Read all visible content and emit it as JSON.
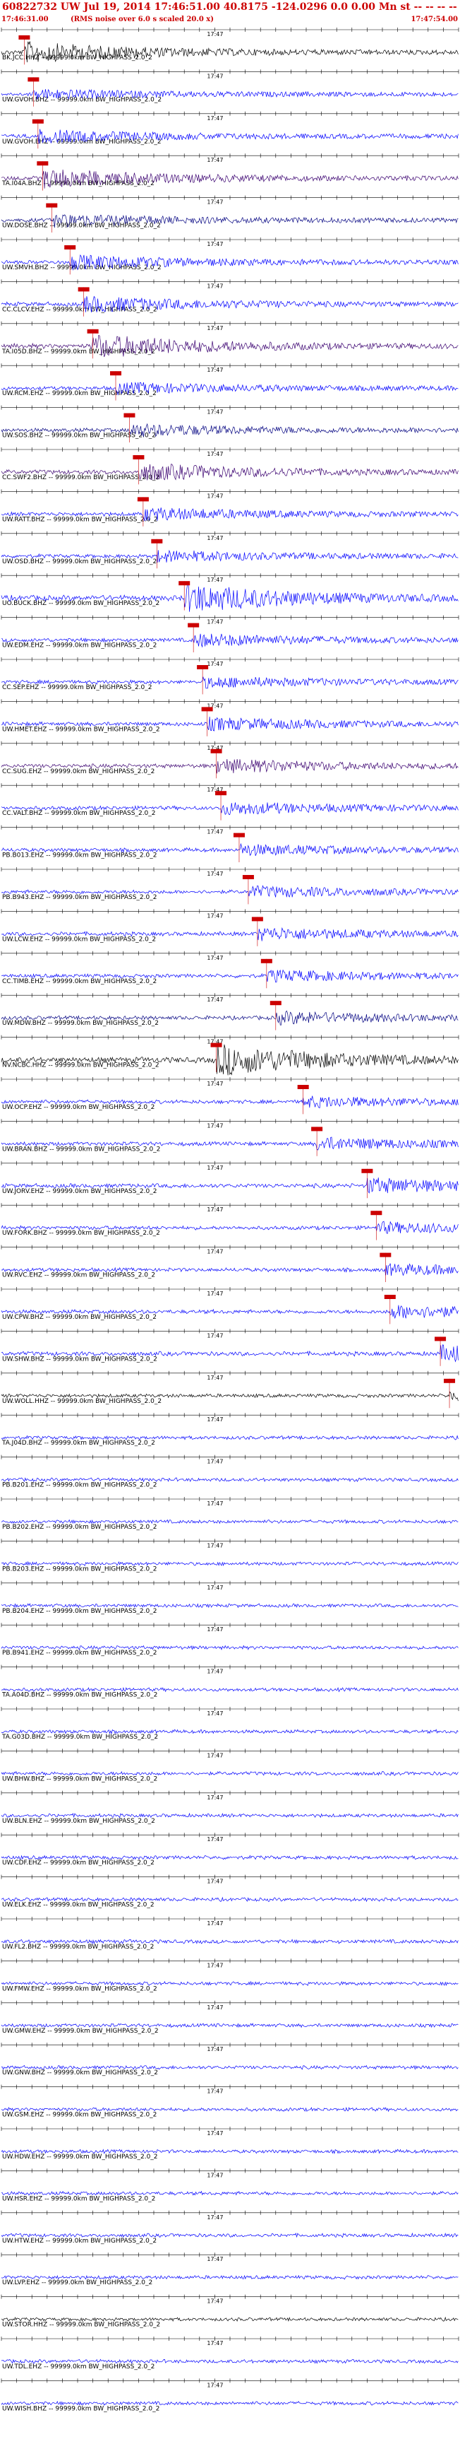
{
  "header": {
    "title": "60822732 UW Jul 19, 2014 17:46:51.00   40.8175 -124.0296  0.0 0.00 Mn st -- -- -- -- -1",
    "title_right": "-1",
    "subtitle": "(RMS noise over 6.0 s scaled 20.0 x)",
    "start_time": "17:46:31.00",
    "end_time": "17:47:54.00"
  },
  "colors": {
    "header": "#cc0000",
    "tick": "#000000",
    "pick": "#cc0000",
    "trace_blue": "#0000ff",
    "trace_navy": "#000080",
    "trace_purple": "#3a0070",
    "trace_black": "#000000"
  },
  "chart_data": {
    "type": "line",
    "time_range": [
      "17:46:31.00",
      "17:47:54.00"
    ],
    "tick_label": "17:47",
    "filter_text": "99999.0km BW_HIGHPASS_2.0_2",
    "traces": [
      {
        "label": "BK.JCC.HHZ",
        "pick": 0.05,
        "amp": 0.6,
        "color": "trace_black"
      },
      {
        "label": "UW.GVOH.BHZ",
        "pick": 0.07,
        "amp": 0.25,
        "color": "trace_blue"
      },
      {
        "label": "UW.GVOH.EHZ",
        "pick": 0.08,
        "amp": 0.35,
        "color": "trace_blue"
      },
      {
        "label": "TA.I04A.BHZ",
        "pick": 0.09,
        "amp": 0.55,
        "color": "trace_purple"
      },
      {
        "label": "UW.DOSE.BHZ",
        "pick": 0.11,
        "amp": 0.35,
        "color": "trace_navy"
      },
      {
        "label": "UW.SMVH.BHZ",
        "pick": 0.15,
        "amp": 0.4,
        "color": "trace_blue"
      },
      {
        "label": "CC.CLCV.EHZ",
        "pick": 0.18,
        "amp": 0.45,
        "color": "trace_blue"
      },
      {
        "label": "TA.I05D.BHZ",
        "pick": 0.2,
        "amp": 0.7,
        "color": "trace_purple"
      },
      {
        "label": "UW.RCM.EHZ",
        "pick": 0.25,
        "amp": 0.3,
        "color": "trace_blue"
      },
      {
        "label": "UW.SOS.BHZ",
        "pick": 0.28,
        "amp": 0.35,
        "color": "trace_navy"
      },
      {
        "label": "CC.SWF2.BHZ",
        "pick": 0.3,
        "amp": 0.5,
        "color": "trace_purple"
      },
      {
        "label": "UW.RATT.BHZ",
        "pick": 0.31,
        "amp": 0.35,
        "color": "trace_blue"
      },
      {
        "label": "UW.OSD.BHZ",
        "pick": 0.34,
        "amp": 0.3,
        "color": "trace_blue"
      },
      {
        "label": "UO.BUCK.BHZ",
        "pick": 0.4,
        "amp": 0.9,
        "color": "trace_blue"
      },
      {
        "label": "UW.EDM.EHZ",
        "pick": 0.42,
        "amp": 0.35,
        "color": "trace_blue"
      },
      {
        "label": "CC.SEP.EHZ",
        "pick": 0.44,
        "amp": 0.3,
        "color": "trace_blue"
      },
      {
        "label": "UW.HMET.EHZ",
        "pick": 0.45,
        "amp": 0.35,
        "color": "trace_blue"
      },
      {
        "label": "CC.SUG.EHZ",
        "pick": 0.47,
        "amp": 0.4,
        "color": "trace_purple"
      },
      {
        "label": "CC.VALT.BHZ",
        "pick": 0.48,
        "amp": 0.35,
        "color": "trace_blue"
      },
      {
        "label": "PB.B013.EHZ",
        "pick": 0.52,
        "amp": 0.3,
        "color": "trace_blue"
      },
      {
        "label": "PB.B943.EHZ",
        "pick": 0.54,
        "amp": 0.3,
        "color": "trace_blue"
      },
      {
        "label": "UW.LCW.EHZ",
        "pick": 0.56,
        "amp": 0.35,
        "color": "trace_blue"
      },
      {
        "label": "CC.TIMB.EHZ",
        "pick": 0.58,
        "amp": 0.3,
        "color": "trace_blue"
      },
      {
        "label": "UW.MDW.BHZ",
        "pick": 0.6,
        "amp": 0.35,
        "color": "trace_navy"
      },
      {
        "label": "NV.NCBC.HHZ",
        "pick": 0.47,
        "amp": 0.95,
        "color": "trace_black"
      },
      {
        "label": "UW.OCP.EHZ",
        "pick": 0.66,
        "amp": 0.3,
        "color": "trace_blue"
      },
      {
        "label": "UW.BRAN.BHZ",
        "pick": 0.69,
        "amp": 0.35,
        "color": "trace_blue"
      },
      {
        "label": "UW.JORV.EHZ",
        "pick": 0.8,
        "amp": 0.45,
        "color": "trace_blue"
      },
      {
        "label": "UW.FORK.BHZ",
        "pick": 0.82,
        "amp": 0.3,
        "color": "trace_blue"
      },
      {
        "label": "UW.RVC.EHZ",
        "pick": 0.84,
        "amp": 0.3,
        "color": "trace_blue"
      },
      {
        "label": "UW.CPW.BHZ",
        "pick": 0.85,
        "amp": 0.35,
        "color": "trace_blue"
      },
      {
        "label": "UW.SHW.BHZ",
        "pick": 0.96,
        "amp": 0.45,
        "color": "trace_blue"
      },
      {
        "label": "UW.WOLL.HHZ",
        "pick": 0.98,
        "amp": 0.25,
        "color": "trace_black"
      },
      {
        "label": "TA.J04D.BHZ",
        "pick": null,
        "amp": 0.2,
        "color": "trace_blue"
      },
      {
        "label": "PB.B201.EHZ",
        "pick": null,
        "amp": 0.2,
        "color": "trace_blue"
      },
      {
        "label": "PB.B202.EHZ",
        "pick": null,
        "amp": 0.2,
        "color": "trace_blue"
      },
      {
        "label": "PB.B203.EHZ",
        "pick": null,
        "amp": 0.2,
        "color": "trace_blue"
      },
      {
        "label": "PB.B204.EHZ",
        "pick": null,
        "amp": 0.2,
        "color": "trace_blue"
      },
      {
        "label": "PB.B941.EHZ",
        "pick": null,
        "amp": 0.2,
        "color": "trace_blue"
      },
      {
        "label": "TA.A04D.BHZ",
        "pick": null,
        "amp": 0.2,
        "color": "trace_blue"
      },
      {
        "label": "TA.G03D.BHZ",
        "pick": null,
        "amp": 0.2,
        "color": "trace_blue"
      },
      {
        "label": "UW.BHW.BHZ",
        "pick": null,
        "amp": 0.25,
        "color": "trace_blue"
      },
      {
        "label": "UW.BLN.EHZ",
        "pick": null,
        "amp": 0.2,
        "color": "trace_blue"
      },
      {
        "label": "UW.CDF.EHZ",
        "pick": null,
        "amp": 0.25,
        "color": "trace_blue"
      },
      {
        "label": "UW.ELK.EHZ",
        "pick": null,
        "amp": 0.2,
        "color": "trace_blue"
      },
      {
        "label": "UW.FL2.BHZ",
        "pick": null,
        "amp": 0.3,
        "color": "trace_blue"
      },
      {
        "label": "UW.FMW.EHZ",
        "pick": null,
        "amp": 0.2,
        "color": "trace_blue"
      },
      {
        "label": "UW.GMW.EHZ",
        "pick": null,
        "amp": 0.2,
        "color": "trace_blue"
      },
      {
        "label": "UW.GNW.BHZ",
        "pick": null,
        "amp": 0.2,
        "color": "trace_blue"
      },
      {
        "label": "UW.GSM.EHZ",
        "pick": null,
        "amp": 0.2,
        "color": "trace_blue"
      },
      {
        "label": "UW.HDW.EHZ",
        "pick": null,
        "amp": 0.2,
        "color": "trace_blue"
      },
      {
        "label": "UW.HSR.EHZ",
        "pick": null,
        "amp": 0.2,
        "color": "trace_blue"
      },
      {
        "label": "UW.HTW.EHZ",
        "pick": null,
        "amp": 0.2,
        "color": "trace_blue"
      },
      {
        "label": "UW.LVP.EHZ",
        "pick": null,
        "amp": 0.2,
        "color": "trace_blue"
      },
      {
        "label": "UW.STOR.HHZ",
        "pick": null,
        "amp": 0.15,
        "color": "trace_black"
      },
      {
        "label": "UW.TDL.EHZ",
        "pick": null,
        "amp": 0.2,
        "color": "trace_blue"
      },
      {
        "label": "UW.WISH.BHZ",
        "pick": null,
        "amp": 0.2,
        "color": "trace_blue"
      }
    ]
  }
}
